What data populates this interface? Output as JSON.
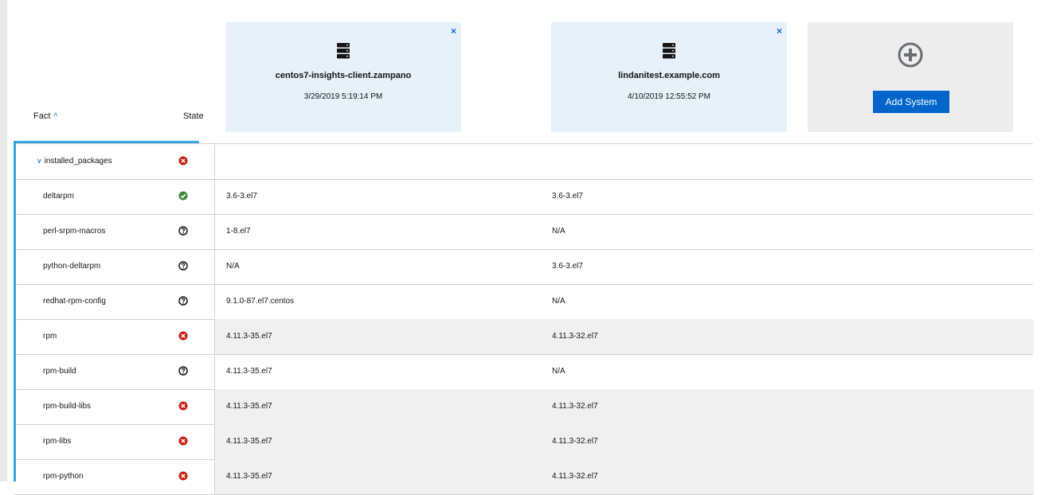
{
  "header": {
    "fact_label": "Fact",
    "state_label": "State"
  },
  "systems": [
    {
      "name": "centos7-insights-client.zampano",
      "date": "3/29/2019 5:19:14 PM",
      "close": "×"
    },
    {
      "name": "lindanitest.example.com",
      "date": "4/10/2019 12:55:52 PM",
      "close": "×"
    }
  ],
  "add_system": {
    "label": "Add System"
  },
  "colors": {
    "accent": "#0066cc",
    "card_bg": "#e7f1fa",
    "add_card_bg": "#ededed",
    "state_different": "#c9190b",
    "state_same": "#3e8635",
    "state_unknown": "#151515"
  },
  "group": {
    "label": "installed_packages",
    "state": "different"
  },
  "rows": [
    {
      "fact": "deltarpm",
      "state": "same",
      "v1": "3.6-3.el7",
      "v2": "3.6-3.el7"
    },
    {
      "fact": "perl-srpm-macros",
      "state": "unknown",
      "v1": "1-8.el7",
      "v2": "N/A"
    },
    {
      "fact": "python-deltarpm",
      "state": "unknown",
      "v1": "N/A",
      "v2": "3.6-3.el7"
    },
    {
      "fact": "redhat-rpm-config",
      "state": "unknown",
      "v1": "9.1.0-87.el7.centos",
      "v2": "N/A"
    },
    {
      "fact": "rpm",
      "state": "different",
      "v1": "4.11.3-35.el7",
      "v2": "4.11.3-32.el7"
    },
    {
      "fact": "rpm-build",
      "state": "unknown",
      "v1": "4.11.3-35.el7",
      "v2": "N/A"
    },
    {
      "fact": "rpm-build-libs",
      "state": "different",
      "v1": "4.11.3-35.el7",
      "v2": "4.11.3-32.el7"
    },
    {
      "fact": "rpm-libs",
      "state": "different",
      "v1": "4.11.3-35.el7",
      "v2": "4.11.3-32.el7"
    },
    {
      "fact": "rpm-python",
      "state": "different",
      "v1": "4.11.3-35.el7",
      "v2": "4.11.3-32.el7"
    }
  ]
}
